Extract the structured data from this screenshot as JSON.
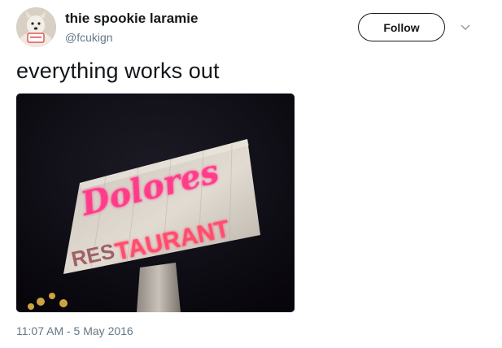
{
  "user": {
    "display_name": "thie spookie laramie",
    "handle": "@fcukign",
    "avatar_icon": "dog-avatar-icon"
  },
  "actions": {
    "follow_label": "Follow",
    "menu_icon": "chevron-down-icon"
  },
  "tweet": {
    "text": "everything works out",
    "timestamp": "11:07 AM - 5 May 2016"
  },
  "media": {
    "sign_word_top": "Dolores",
    "sign_word_bottom_faded": "RES",
    "sign_word_bottom": "TAURANT"
  },
  "colors": {
    "text_primary": "#14171a",
    "text_secondary": "#657786",
    "neon_pink": "#ff3c8a",
    "neon_red": "#d81e3a"
  }
}
